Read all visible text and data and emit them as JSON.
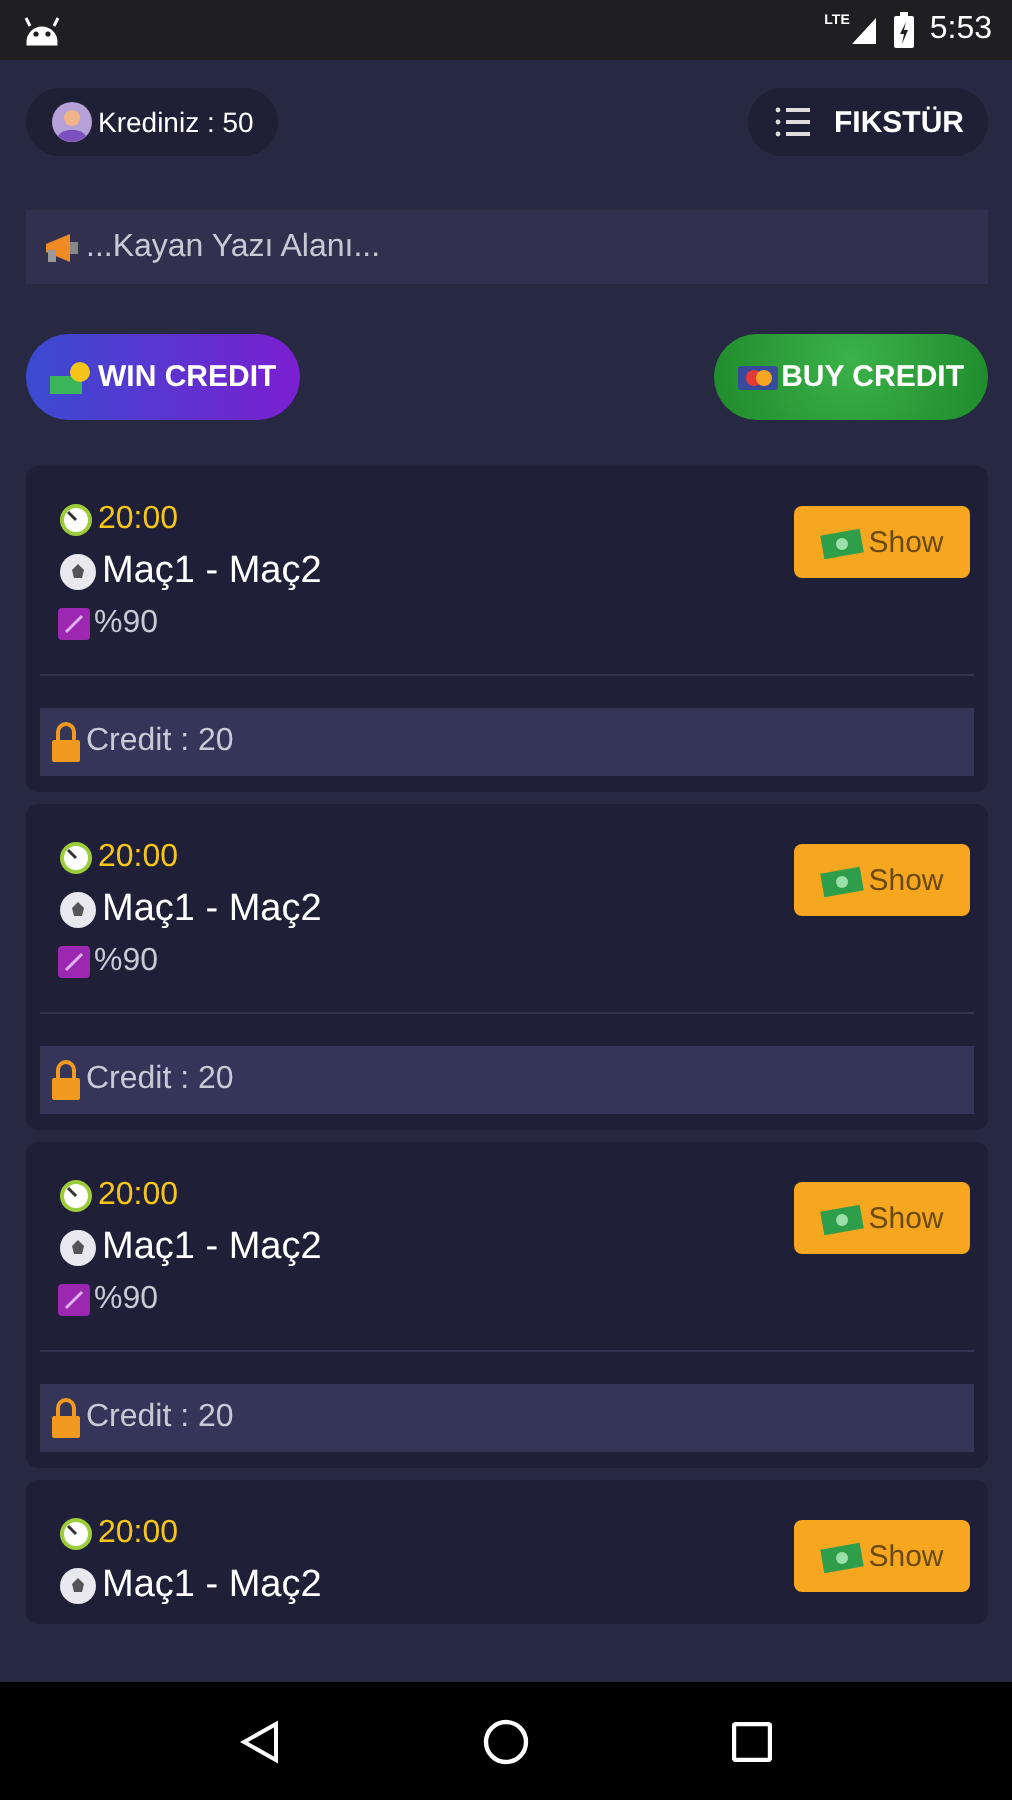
{
  "status_bar": {
    "time": "5:53",
    "network": "LTE"
  },
  "header": {
    "credit_label": "Krediniz : 50",
    "fixture_button": "FIKSTÜR"
  },
  "ticker": {
    "text": "...Kayan Yazı Alanı..."
  },
  "actions": [
    {
      "kind": "win",
      "label": "WIN CREDIT"
    },
    {
      "kind": "buy",
      "label": "BUY CREDIT"
    }
  ],
  "matches": [
    {
      "time": "20:00",
      "teams": "Maç1 - Maç2",
      "percent": "%90",
      "credit": "Credit : 20",
      "button": "Show"
    },
    {
      "time": "20:00",
      "teams": "Maç1 - Maç2",
      "percent": "%90",
      "credit": "Credit : 20",
      "button": "Show"
    },
    {
      "time": "20:00",
      "teams": "Maç1 - Maç2",
      "percent": "%90",
      "credit": "Credit : 20",
      "button": "Show"
    },
    {
      "time": "20:00",
      "teams": "Maç1 - Maç2",
      "button": "Show"
    }
  ]
}
